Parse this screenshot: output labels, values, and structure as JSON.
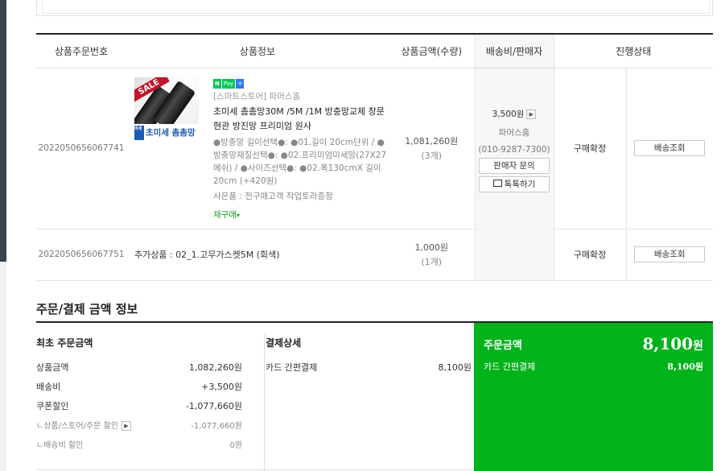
{
  "table": {
    "headers": {
      "order_no": "상품주문번호",
      "info": "상품정보",
      "price": "상품금액(수량)",
      "ship": "배송비/판매자",
      "status": "진행상태"
    },
    "item1": {
      "order_no": "2022050656067741",
      "npay": {
        "n": "N",
        "pay": "Pay",
        "plus": "+"
      },
      "thumb": {
        "sale": "SALE",
        "label": "초미세 촘촘망",
        "mark": "미세"
      },
      "store": "[스마트스토어] 파머스홈",
      "name": "초미세 촘촘망30M /5M /1M 방충망교체 창문 현관 방진망 프리미엄 원사",
      "options": "●방충망 길이선택●: ●01.길이 20cm단위 / ●방충망재질선택●: ●02.프리미엄미세망(27X27메쉬) / ●사이즈선택●: ●02.폭130cmX 길이20cm (+420원)",
      "gift": "사은품 : 전구매고객 작업토라증정",
      "rebuy": "재구매",
      "price": "1,081,260원",
      "qty": "(3개)",
      "ship_fee": "3,500원",
      "seller": "파머스홈",
      "phone": "(010-9287-7300)",
      "seller_inquiry": "판매자 문의",
      "talk": "톡톡하기",
      "status": "구매확정",
      "track": "배송조회"
    },
    "item2": {
      "order_no": "2022050656067751",
      "name": "추가상품 : 02_1.고무가스켓5M (회색)",
      "price": "1,000원",
      "qty": "(1개)",
      "status": "구매확정",
      "track": "배송조회"
    }
  },
  "summary": {
    "title": "주문/결제 금액 정보",
    "left": {
      "head": "최초 주문금액",
      "rows": [
        {
          "label": "상품금액",
          "value": "1,082,260원"
        },
        {
          "label": "배송비",
          "value": "+3,500원"
        },
        {
          "label": "쿠폰할인",
          "value": "-1,077,660원"
        },
        {
          "label": "ㄴ상품/스토어/주문 할인",
          "value": "-1,077,660원"
        },
        {
          "label": "ㄴ배송비 할인",
          "value": "0원"
        }
      ]
    },
    "mid": {
      "head": "결제상세",
      "label": "카드 간편결제",
      "value": "8,100원"
    },
    "right": {
      "label": "주문금액",
      "amount": "8,100",
      "won": "원",
      "pay_label": "카드 간편결제",
      "pay_value": "8,100원"
    }
  },
  "colors": {
    "accent_green": "#00b31a",
    "npay_green": "#03c75a",
    "rebuy_green": "#1aa31a"
  }
}
